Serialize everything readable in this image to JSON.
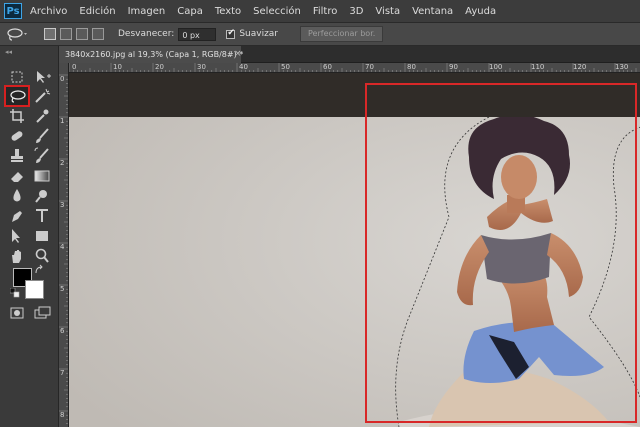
{
  "app": {
    "logo": "Ps"
  },
  "menu": [
    "Archivo",
    "Edición",
    "Imagen",
    "Capa",
    "Texto",
    "Selección",
    "Filtro",
    "3D",
    "Vista",
    "Ventana",
    "Ayuda"
  ],
  "options": {
    "feather_label": "Desvanecer:",
    "feather_value": "0 px",
    "antialias_label": "Suavizar",
    "refine_button": "Perfeccionar bor."
  },
  "document": {
    "tab_title": "3840x2160.jpg al 19,3% (Capa 1, RGB/8#) *",
    "close_glyph": "×"
  },
  "rulers": {
    "top": [
      "0",
      "10",
      "20",
      "30",
      "40",
      "50",
      "60",
      "70",
      "80",
      "90",
      "100",
      "110",
      "120",
      "130"
    ],
    "left": [
      "0",
      "1",
      "2",
      "3",
      "4",
      "5",
      "6",
      "7",
      "8"
    ]
  },
  "toolbar": {
    "collapse_glyph": "◂◂"
  },
  "tools": [
    {
      "name": "rectangular-marquee-icon"
    },
    {
      "name": "move-icon"
    },
    {
      "name": "lasso-icon",
      "selected": true
    },
    {
      "name": "magic-wand-icon"
    },
    {
      "name": "crop-icon"
    },
    {
      "name": "eyedropper-icon"
    },
    {
      "name": "spot-healing-icon"
    },
    {
      "name": "brush-icon"
    },
    {
      "name": "clone-stamp-icon"
    },
    {
      "name": "history-brush-icon"
    },
    {
      "name": "eraser-icon"
    },
    {
      "name": "gradient-icon"
    },
    {
      "name": "blur-icon"
    },
    {
      "name": "dodge-icon"
    },
    {
      "name": "pen-icon"
    },
    {
      "name": "type-icon"
    },
    {
      "name": "path-selection-icon"
    },
    {
      "name": "rectangle-shape-icon"
    },
    {
      "name": "hand-icon"
    },
    {
      "name": "zoom-icon"
    }
  ],
  "colors": {
    "foreground": "#000000",
    "background": "#ffffff",
    "highlight": "#d82828",
    "accent": "#3ea4e6"
  }
}
